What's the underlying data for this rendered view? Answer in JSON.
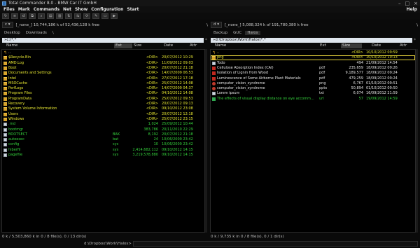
{
  "window": {
    "title": "Total Commander 8.0 - BMW Car IT GmbH",
    "minimize": "–",
    "maximize": "□",
    "close": "×"
  },
  "menu": {
    "items": [
      "Files",
      "Mark",
      "Commands",
      "Net",
      "Show",
      "Configuration",
      "Start"
    ],
    "help": "Help"
  },
  "toolbar": {
    "left_drive": "d",
    "right_drive": "d"
  },
  "left": {
    "drive": "c",
    "drive_info": "[_none_]  10,744,186 k of 52,436,128 k free",
    "drive_end": "\\",
    "tabs": [
      "Desktop",
      "Downloads",
      "\\"
    ],
    "path": "»c:\\*.*",
    "path_end": "*",
    "headers": {
      "name": "Name",
      "ext": "Ext",
      "size": "Size",
      "date": "Date",
      "attr": "Attr"
    },
    "rows": [
      {
        "icon": "up",
        "name": "..",
        "ext": "",
        "size": "",
        "date": "",
        "cls": "wht"
      },
      {
        "icon": "folder",
        "name": "$Recycle.Bin",
        "ext": "",
        "size": "<DIR>",
        "date": "20/07/2012 10:29",
        "cls": "yel"
      },
      {
        "icon": "folder",
        "name": "AMD.Log",
        "ext": "",
        "size": "<DIR>",
        "date": "11/09/2012 09:03",
        "cls": "yel"
      },
      {
        "icon": "folder",
        "name": "Boot",
        "ext": "",
        "size": "<DIR>",
        "date": "20/07/2012 21:18",
        "cls": "yel"
      },
      {
        "icon": "folder",
        "name": "Documents and Settings",
        "ext": "",
        "size": "<DIR>",
        "date": "14/07/2009 06:53",
        "cls": "yel"
      },
      {
        "icon": "folder",
        "name": "Intel",
        "ext": "",
        "size": "<DIR>",
        "date": "27/07/2012 17:18",
        "cls": "yel"
      },
      {
        "icon": "folder",
        "name": "MSOCache",
        "ext": "",
        "size": "<DIR>",
        "date": "25/07/2012 14:08",
        "cls": "yel"
      },
      {
        "icon": "folder",
        "name": "PerfLogs",
        "ext": "",
        "size": "<DIR>",
        "date": "14/07/2009 04:37",
        "cls": "yel"
      },
      {
        "icon": "folder",
        "name": "Program Files",
        "ext": "",
        "size": "<DIR>",
        "date": "04/10/2012 14:08",
        "cls": "yel"
      },
      {
        "icon": "folder",
        "name": "ProgramData",
        "ext": "",
        "size": "<DIR>",
        "date": "25/07/2012 09:53",
        "cls": "yel"
      },
      {
        "icon": "folder",
        "name": "Recovery",
        "ext": "",
        "size": "<DIR>",
        "date": "20/07/2012 09:13",
        "cls": "yel"
      },
      {
        "icon": "folder",
        "name": "System Volume Information",
        "ext": "",
        "size": "<DIR>",
        "date": "09/10/2012 23:08",
        "cls": "yel"
      },
      {
        "icon": "folder",
        "name": "Users",
        "ext": "",
        "size": "<DIR>",
        "date": "20/07/2012 12:18",
        "cls": "yel"
      },
      {
        "icon": "folder",
        "name": "Windows",
        "ext": "",
        "size": "<DIR>",
        "date": "25/07/2012 23:15",
        "cls": "yel"
      },
      {
        "icon": "file",
        "name": ".rnd",
        "ext": "",
        "size": "1,024",
        "date": "25/09/2012 10:44",
        "cls": "grnt"
      },
      {
        "icon": "file",
        "name": "bootmgr",
        "ext": "",
        "size": "383,786",
        "date": "20/11/2010 22:29",
        "cls": "grnt"
      },
      {
        "icon": "file",
        "name": "BOOTSECT",
        "ext": "BAK",
        "size": "8,192",
        "date": "20/07/2012 21:18",
        "cls": "grnt"
      },
      {
        "icon": "file",
        "name": "autoexec",
        "ext": "bat",
        "size": "24",
        "date": "10/06/2009 23:42",
        "cls": "grnt"
      },
      {
        "icon": "file",
        "name": "config",
        "ext": "sys",
        "size": "10",
        "date": "10/06/2009 23:42",
        "cls": "grnt"
      },
      {
        "icon": "file",
        "name": "hiberfil",
        "ext": "sys",
        "size": "2,414,682,112",
        "date": "09/10/2012 14:15",
        "cls": "grnt"
      },
      {
        "icon": "file",
        "name": "pagefile",
        "ext": "sys",
        "size": "3,219,578,880",
        "date": "09/10/2012 14:15",
        "cls": "grnt"
      }
    ],
    "status": "0 k / 5,503,860 k in 0 / 8 file(s), 0 / 13 dir(s)"
  },
  "right": {
    "drive": "d",
    "drive_info": "[_none_]  5,088,324 k of 191,780,380 k free",
    "drive_end": "\\",
    "tabs": [
      "Backup",
      "GUC",
      "Halos"
    ],
    "path": "»d:\\Dropbox\\Work\\Halos\\*.*",
    "path_end": "*",
    "headers": {
      "name": "Name",
      "ext": "Ext",
      "size": "Size",
      "date": "Date",
      "attr": "Attr"
    },
    "rows": [
      {
        "icon": "up",
        "name": "..",
        "ext": "",
        "size": "<DIR>",
        "date": "10/10/2012 09:59",
        "cls": "yel"
      },
      {
        "icon": "folder",
        "name": "png",
        "ext": "",
        "size": "<DIR>",
        "date": "10/10/2012 10:13",
        "cls": "yel",
        "selected": true
      },
      {
        "icon": "file",
        "name": "Todo",
        "ext": "",
        "size": "494",
        "date": "21/09/2012 14:54",
        "cls": "wht"
      },
      {
        "icon": "pdf",
        "name": "Cellulose Absorption Index (CAI)",
        "ext": "pdf",
        "size": "235,659",
        "date": "18/09/2012 09:26",
        "cls": "wht"
      },
      {
        "icon": "pdf",
        "name": "Isolation of Lignin from Wood",
        "ext": "pdf",
        "size": "9,189,577",
        "date": "18/09/2012 09:24",
        "cls": "wht"
      },
      {
        "icon": "pdf",
        "name": "Luminescence of Some Airborne Plant Materials",
        "ext": "pdf",
        "size": "479,259",
        "date": "18/09/2012 09:24",
        "cls": "wht"
      },
      {
        "icon": "red",
        "name": "computer_vision_syndrome",
        "ext": "png",
        "size": "6,767",
        "date": "01/10/2012 09:51",
        "cls": "wht"
      },
      {
        "icon": "red",
        "name": "computer_vision_syndrome",
        "ext": "pptx",
        "size": "50,894",
        "date": "01/10/2012 09:50",
        "cls": "wht"
      },
      {
        "icon": "file",
        "name": "Lorem ipsum",
        "ext": "txt",
        "size": "6,074",
        "date": "16/09/2012 21:59",
        "cls": "wht"
      },
      {
        "icon": "grn",
        "name": "The effects of visual display distance on eye accomm...",
        "ext": "url",
        "size": "57",
        "date": "19/09/2012 14:59",
        "cls": "grnt"
      }
    ],
    "status": "0 k / 9,735 k in 0 / 8 file(s), 0 / 1 dir(s)"
  },
  "cmdline": {
    "path": "d:\\Dropbox\\Work\\Halos>"
  },
  "colors": {
    "folder": "#e6e632",
    "file": "#34d23c",
    "selection": "#e6d23c",
    "background": "#000000"
  }
}
